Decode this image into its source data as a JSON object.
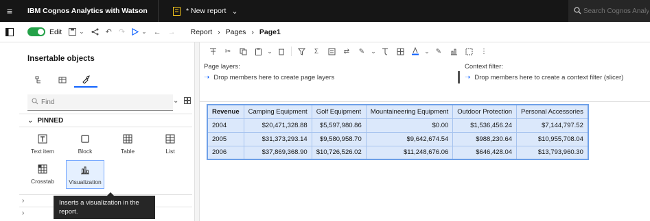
{
  "app": {
    "title": "IBM Cognos Analytics with Watson",
    "report_title": "* New report",
    "search_placeholder": "Search Cognos Analytics"
  },
  "toolbar": {
    "edit_label": "Edit",
    "breadcrumb": [
      "Report",
      "Pages",
      "Page1"
    ]
  },
  "left_panel": {
    "heading": "Insertable objects",
    "search_placeholder": "Find",
    "section_label": "PINNED",
    "objects": [
      {
        "label": "Text item",
        "icon": "text-item-icon"
      },
      {
        "label": "Block",
        "icon": "block-icon"
      },
      {
        "label": "Table",
        "icon": "table-icon"
      },
      {
        "label": "List",
        "icon": "list-icon"
      },
      {
        "label": "Crosstab",
        "icon": "crosstab-icon"
      },
      {
        "label": "Visualization",
        "icon": "visualization-icon",
        "selected": true
      }
    ],
    "tooltip": "Inserts a visualization in the report."
  },
  "canvas": {
    "page_layers_label": "Page layers:",
    "page_layers_drop": "Drop members here to create page layers",
    "context_filter_label": "Context filter:",
    "context_filter_drop": "Drop members here to create a context filter (slicer)"
  },
  "crosstab": {
    "corner": "Revenue",
    "columns": [
      "Camping Equipment",
      "Golf Equipment",
      "Mountaineering Equipment",
      "Outdoor Protection",
      "Personal Accessories"
    ],
    "rows": [
      {
        "year": "2004",
        "values": [
          "$20,471,328.88",
          "$5,597,980.86",
          "$0.00",
          "$1,536,456.24",
          "$7,144,797.52"
        ]
      },
      {
        "year": "2005",
        "values": [
          "$31,373,293.14",
          "$9,580,958.70",
          "$9,642,674.54",
          "$988,230.64",
          "$10,955,708.04"
        ]
      },
      {
        "year": "2006",
        "values": [
          "$37,869,368.90",
          "$10,726,526.02",
          "$11,248,676.06",
          "$646,428.04",
          "$13,793,960.30"
        ]
      }
    ]
  },
  "colors": {
    "topbar": "#161616",
    "accent": "#0f62fe",
    "toggle_on": "#24a148",
    "crosstab_fill": "#dbe8fb"
  }
}
